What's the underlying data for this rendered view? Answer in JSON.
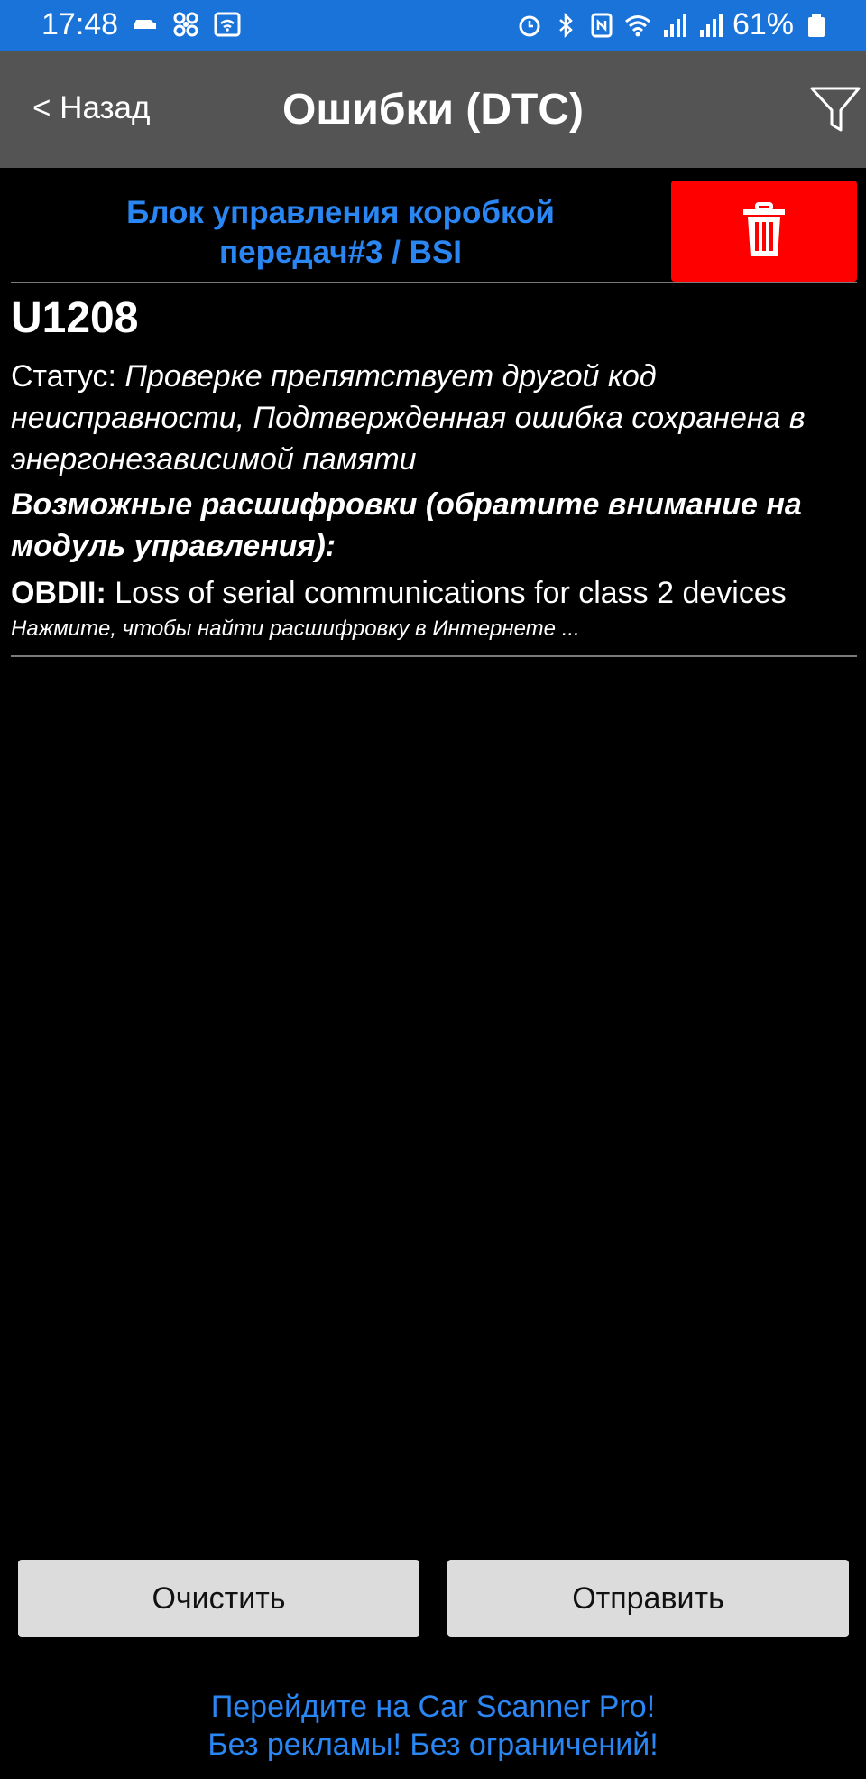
{
  "status_bar": {
    "time": "17:48",
    "battery_percent": "61%",
    "icons_left": [
      "car-icon",
      "fan-icon",
      "wifi-hotspot-icon"
    ],
    "icons_right": [
      "alarm-icon",
      "bluetooth-icon",
      "nfc-icon",
      "wifi-icon",
      "signal-icon",
      "signal-icon",
      "battery-icon"
    ]
  },
  "header": {
    "back_label": "< Назад",
    "title": "Ошибки (DTC)"
  },
  "module": {
    "name": "Блок управления коробкой передач#3 / BSI"
  },
  "dtc": {
    "code": "U1208",
    "status_label": "Статус: ",
    "status_value": "Проверке препятствует другой код неисправности, Подтвержденная ошибка сохранена в энергонезависимой памяти",
    "possible_title": "Возможные расшифровки (обратите внимание на модуль управления):",
    "obd_label": "OBDII:",
    "obd_text": " Loss of serial communications for class 2 devices",
    "hint": "Нажмите, чтобы найти расшифровку в Интернете ..."
  },
  "buttons": {
    "clear": "Очистить",
    "send": "Отправить"
  },
  "promo": {
    "line1": "Перейдите на Car Scanner Pro!",
    "line2": "Без рекламы! Без ограничений!"
  },
  "colors": {
    "status_bar": "#1a73d9",
    "header": "#545454",
    "accent_blue": "#2a86f3",
    "delete_red": "#ff0000",
    "button_gray": "#dcdcdc"
  }
}
